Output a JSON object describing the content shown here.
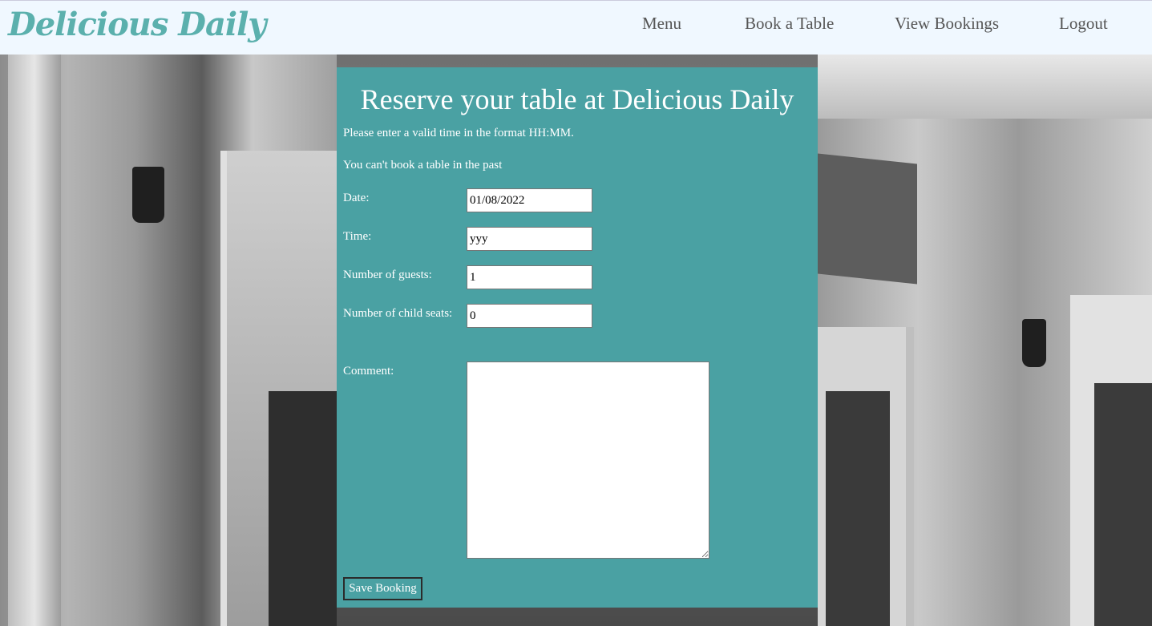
{
  "brand": "Delicious Daily",
  "nav": {
    "menu": "Menu",
    "book": "Book a Table",
    "view": "View Bookings",
    "logout": "Logout"
  },
  "form": {
    "title": "Reserve your table at Delicious Daily",
    "errors": [
      "Please enter a valid time in the format HH:MM.",
      "You can't book a table in the past"
    ],
    "date_label": "Date:",
    "date_value": "01/08/2022",
    "time_label": "Time:",
    "time_value": "yyy",
    "guests_label": "Number of guests:",
    "guests_value": "1",
    "child_label": "Number of child seats:",
    "child_value": "0",
    "comment_label": "Comment:",
    "comment_value": "",
    "save_label": "Save Booking"
  },
  "colors": {
    "brand": "#5bb0ad",
    "navbar_bg": "#f0f8ff",
    "panel_bg": "#4aa1a3"
  }
}
